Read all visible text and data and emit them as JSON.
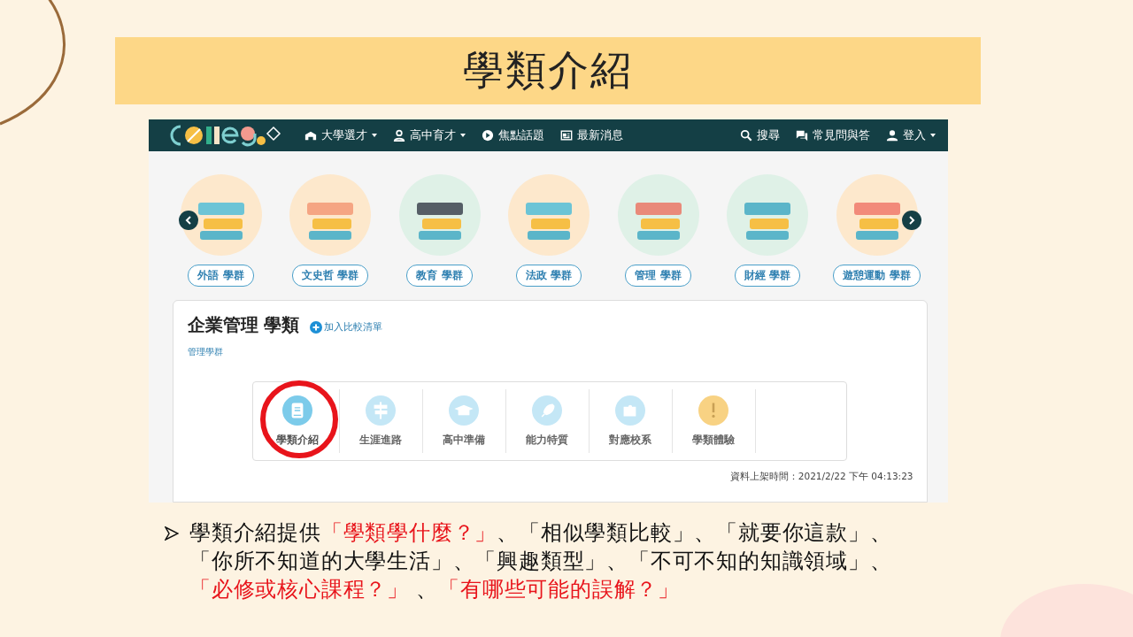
{
  "slide_title": "學類介紹",
  "site": {
    "nav_left": [
      {
        "label": "大學選才",
        "dropdown": true
      },
      {
        "label": "高中育才",
        "dropdown": true
      },
      {
        "label": "焦點話題",
        "dropdown": false
      },
      {
        "label": "最新消息",
        "dropdown": false
      }
    ],
    "nav_right": [
      {
        "label": "搜尋",
        "dropdown": false
      },
      {
        "label": "常見問與答",
        "dropdown": false
      },
      {
        "label": "登入",
        "dropdown": true
      }
    ],
    "groups": [
      {
        "label": "外語 學群"
      },
      {
        "label": "文史哲 學群"
      },
      {
        "label": "教育 學群"
      },
      {
        "label": "法政 學群"
      },
      {
        "label": "管理 學群"
      },
      {
        "label": "財經 學群"
      },
      {
        "label": "遊憩運動 學群"
      }
    ],
    "card": {
      "title": "企業管理 學類",
      "add_link": "加入比較清單",
      "group_link": "管理學群",
      "tabs": [
        {
          "label": "學類介紹",
          "color": "#7ccbea",
          "selected": true,
          "circled": true
        },
        {
          "label": "生涯進路",
          "color": "#c4e7f6",
          "selected": false,
          "circled": false
        },
        {
          "label": "高中準備",
          "color": "#c4e7f6",
          "selected": false,
          "circled": false
        },
        {
          "label": "能力特質",
          "color": "#c4e7f6",
          "selected": false,
          "circled": false
        },
        {
          "label": "對應校系",
          "color": "#c4e7f6",
          "selected": false,
          "circled": false
        },
        {
          "label": "學類體驗",
          "color": "#f8d283",
          "selected": false,
          "circled": false
        }
      ],
      "timestamp": "資料上架時間：2021/2/22 下午 04:13:23"
    }
  },
  "bullet": [
    {
      "text": "學類介紹提供",
      "highlighted": false
    },
    {
      "text": "「學類學什麼？」",
      "highlighted": true
    },
    {
      "text": "、「相似學類比較」、「就要你這款」、「你所不知道的大學生活」、「興趣類型」、「不可不知的知識領域」、",
      "highlighted": false
    },
    {
      "text": "「必修或核心課程？」",
      "highlighted": true
    },
    {
      "text": " 、",
      "highlighted": false
    },
    {
      "text": "「有哪些可能的誤解？」",
      "highlighted": true
    }
  ]
}
